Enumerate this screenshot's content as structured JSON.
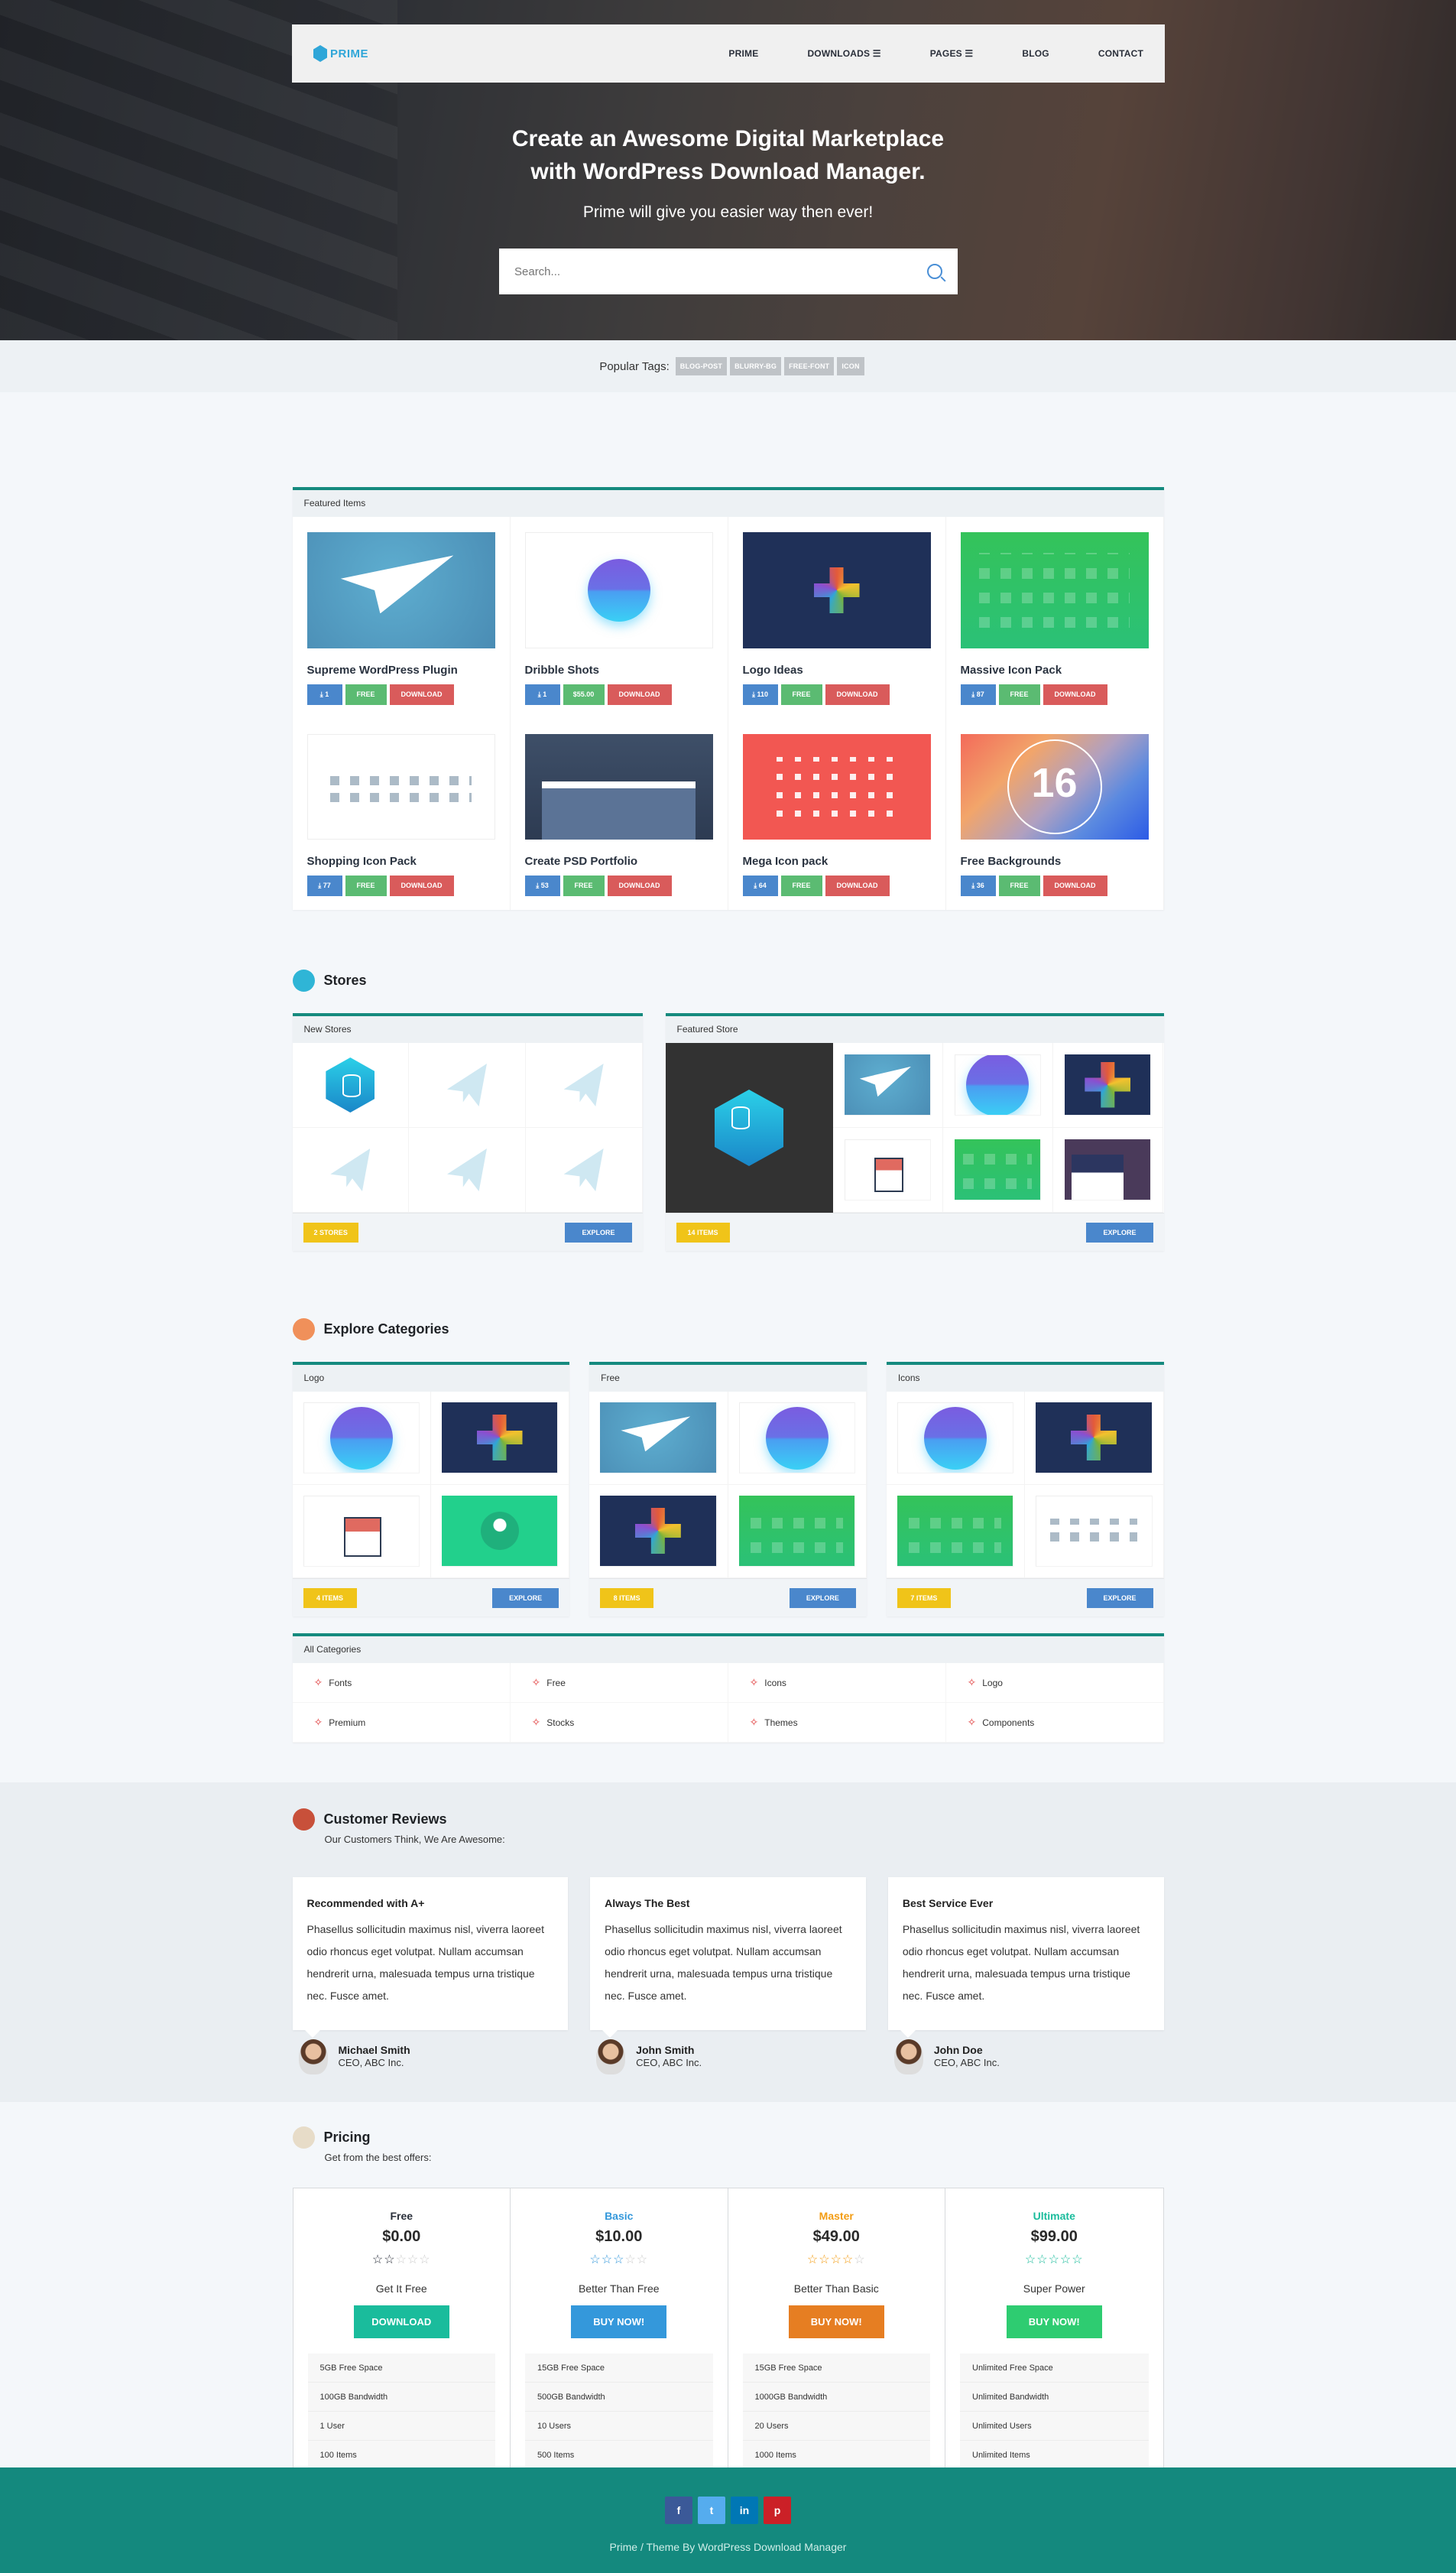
{
  "nav": {
    "logo": "PRIME",
    "items": [
      {
        "label": "PRIME",
        "has_menu": false
      },
      {
        "label": "DOWNLOADS ☰",
        "has_menu": true
      },
      {
        "label": "PAGES ☰",
        "has_menu": true
      },
      {
        "label": "BLOG",
        "has_menu": false
      },
      {
        "label": "CONTACT",
        "has_menu": false
      }
    ]
  },
  "hero": {
    "title_line1": "Create an Awesome Digital Marketplace",
    "title_line2": "with WordPress Download Manager.",
    "subtitle": "Prime will give you easier way then ever!",
    "search_placeholder": "Search..."
  },
  "tags": {
    "label": "Popular Tags:",
    "items": [
      "BLOG-POST",
      "BLURRY-BG",
      "FREE-FONT",
      "ICON"
    ]
  },
  "featured": {
    "header": "Featured Items",
    "download_label": "DOWNLOAD",
    "items": [
      {
        "title": "Supreme WordPress Plugin",
        "downloads": "1",
        "price": "FREE"
      },
      {
        "title": "Dribble Shots",
        "downloads": "1",
        "price": "$55.00"
      },
      {
        "title": "Logo Ideas",
        "downloads": "110",
        "price": "FREE"
      },
      {
        "title": "Massive Icon Pack",
        "downloads": "87",
        "price": "FREE"
      },
      {
        "title": "Shopping Icon Pack",
        "downloads": "77",
        "price": "FREE"
      },
      {
        "title": "Create PSD Portfolio",
        "downloads": "53",
        "price": "FREE"
      },
      {
        "title": "Mega Icon pack",
        "downloads": "64",
        "price": "FREE"
      },
      {
        "title": "Free Backgrounds",
        "downloads": "36",
        "price": "FREE"
      }
    ]
  },
  "stores": {
    "title": "Stores",
    "new_header": "New Stores",
    "new_count": "2 STORES",
    "featured_header": "Featured Store",
    "featured_count": "14 ITEMS",
    "explore": "EXPLORE"
  },
  "categories": {
    "title": "Explore Categories",
    "explore": "EXPLORE",
    "panels": [
      {
        "name": "Logo",
        "count": "4 ITEMS"
      },
      {
        "name": "Free",
        "count": "8 ITEMS"
      },
      {
        "name": "Icons",
        "count": "7 ITEMS"
      }
    ],
    "all_header": "All Categories",
    "all": [
      "Fonts",
      "Free",
      "Icons",
      "Logo",
      "Premium",
      "Stocks",
      "Themes",
      "Components"
    ]
  },
  "reviews": {
    "title": "Customer Reviews",
    "subtitle": "Our Customers Think, We Are Awesome:",
    "items": [
      {
        "heading": "Recommended with A+",
        "text": "Phasellus sollicitudin maximus nisl, viverra laoreet odio rhoncus eget volutpat. Nullam accumsan hendrerit urna, malesuada tempus urna tristique nec. Fusce amet.",
        "name": "Michael Smith",
        "role": "CEO, ABC Inc."
      },
      {
        "heading": "Always The Best",
        "text": "Phasellus sollicitudin maximus nisl, viverra laoreet odio rhoncus eget volutpat. Nullam accumsan hendrerit urna, malesuada tempus urna tristique nec. Fusce amet.",
        "name": "John Smith",
        "role": "CEO, ABC Inc."
      },
      {
        "heading": "Best Service Ever",
        "text": "Phasellus sollicitudin maximus nisl, viverra laoreet odio rhoncus eget volutpat. Nullam accumsan hendrerit urna, malesuada tempus urna tristique nec. Fusce amet.",
        "name": "John Doe",
        "role": "CEO, ABC Inc."
      }
    ]
  },
  "pricing": {
    "title": "Pricing",
    "subtitle": "Get from the best offers:",
    "plans": [
      {
        "name": "Free",
        "price": "$0.00",
        "rating": 2,
        "tagline": "Get It Free",
        "button": "DOWNLOAD",
        "color": "#2a2f3a",
        "btn_color": "#1abc9c",
        "features": [
          "5GB Free Space",
          "100GB Bandwidth",
          "1 User",
          "100 Items"
        ]
      },
      {
        "name": "Basic",
        "price": "$10.00",
        "rating": 3,
        "tagline": "Better Than Free",
        "button": "BUY NOW!",
        "color": "#3498db",
        "btn_color": "#3498db",
        "features": [
          "15GB Free Space",
          "500GB Bandwidth",
          "10 Users",
          "500 Items"
        ]
      },
      {
        "name": "Master",
        "price": "$49.00",
        "rating": 4,
        "tagline": "Better Than Basic",
        "button": "BUY NOW!",
        "color": "#f39c12",
        "btn_color": "#e67e22",
        "features": [
          "15GB Free Space",
          "1000GB Bandwidth",
          "20 Users",
          "1000 Items"
        ]
      },
      {
        "name": "Ultimate",
        "price": "$99.00",
        "rating": 5,
        "tagline": "Super Power",
        "button": "BUY NOW!",
        "color": "#1abc9c",
        "btn_color": "#2ecc71",
        "features": [
          "Unlimited Free Space",
          "Unlimited Bandwidth",
          "Unlimited Users",
          "Unlimited Items"
        ]
      }
    ]
  },
  "footer": {
    "social": [
      {
        "icon": "facebook-icon",
        "glyph": "f",
        "color": "#3b5998"
      },
      {
        "icon": "twitter-icon",
        "glyph": "t",
        "color": "#55acee"
      },
      {
        "icon": "linkedin-icon",
        "glyph": "in",
        "color": "#0077b5"
      },
      {
        "icon": "pinterest-icon",
        "glyph": "p",
        "color": "#cb2027"
      }
    ],
    "text": "Prime  /  Theme By WordPress Download Manager"
  },
  "colors": {
    "accent": "#158a7e",
    "blue": "#4a87cc",
    "green": "#5bbb72",
    "red": "#d95b5b",
    "yellow": "#f0c419"
  }
}
